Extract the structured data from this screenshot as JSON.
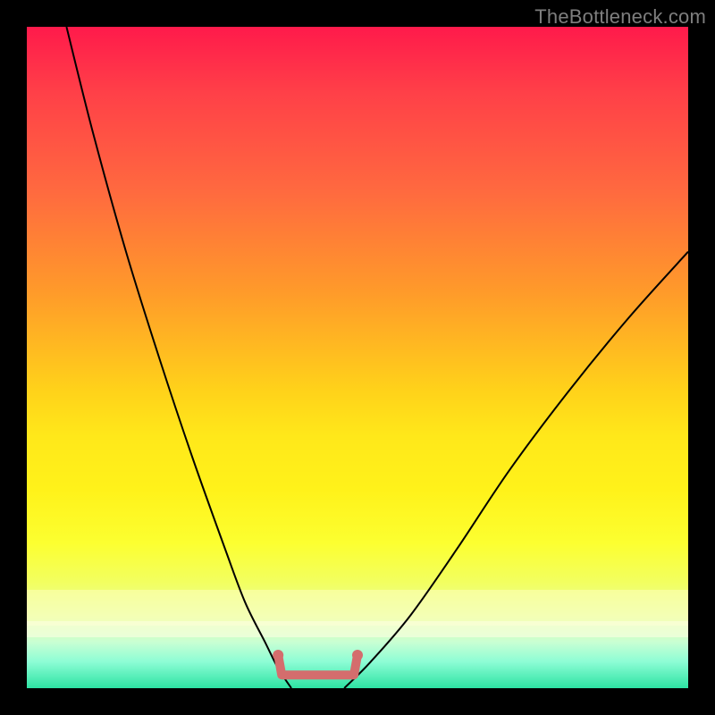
{
  "watermark": "TheBottleneck.com",
  "colors": {
    "curve": "#000000",
    "bracket": "#d46d6d",
    "frame": "#000000"
  },
  "chart_data": {
    "type": "line",
    "title": "",
    "xlabel": "",
    "ylabel": "",
    "xlim": [
      0,
      100
    ],
    "ylim": [
      0,
      100
    ],
    "series": [
      {
        "name": "left-branch",
        "x": [
          6,
          10,
          15,
          20,
          25,
          30,
          33,
          36,
          38,
          40
        ],
        "y": [
          100,
          84,
          66,
          50,
          35,
          21,
          13,
          7,
          3,
          0
        ]
      },
      {
        "name": "right-branch",
        "x": [
          48,
          52,
          58,
          65,
          73,
          82,
          91,
          100
        ],
        "y": [
          0,
          4,
          11,
          21,
          33,
          45,
          56,
          66
        ]
      }
    ],
    "annotations": [
      {
        "name": "plateau-bracket",
        "x_start": 38,
        "x_end": 50,
        "y": 2
      }
    ]
  }
}
